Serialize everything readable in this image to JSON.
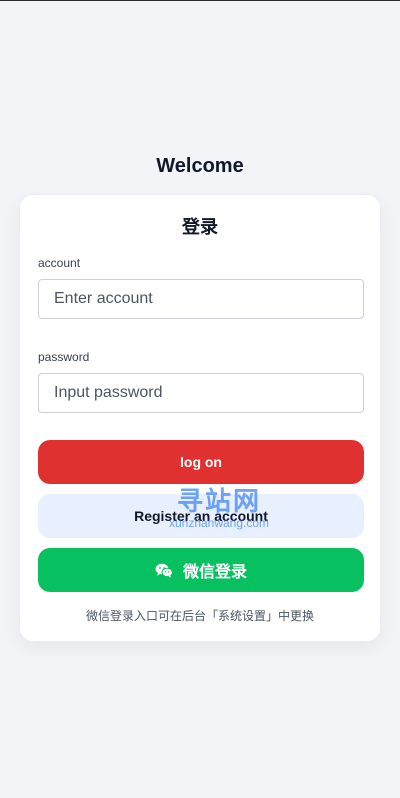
{
  "page": {
    "welcome": "Welcome"
  },
  "login_card": {
    "title": "登录",
    "account_label": "account",
    "account_placeholder": "Enter account",
    "account_value": "",
    "password_label": "password",
    "password_placeholder": "Input password",
    "password_value": "",
    "login_button": "log on",
    "register_button": "Register an account",
    "wechat_button": "微信登录",
    "hint": "微信登录入口可在后台「系统设置」中更换"
  },
  "watermark": {
    "text_cn": "寻站网",
    "text_en": "xunzhanwang.com"
  },
  "colors": {
    "login_button": "#e03131",
    "register_button": "#e8effe",
    "wechat_button": "#07c05f",
    "background": "#f3f4f8"
  },
  "icons": {
    "wechat": "wechat-icon"
  }
}
